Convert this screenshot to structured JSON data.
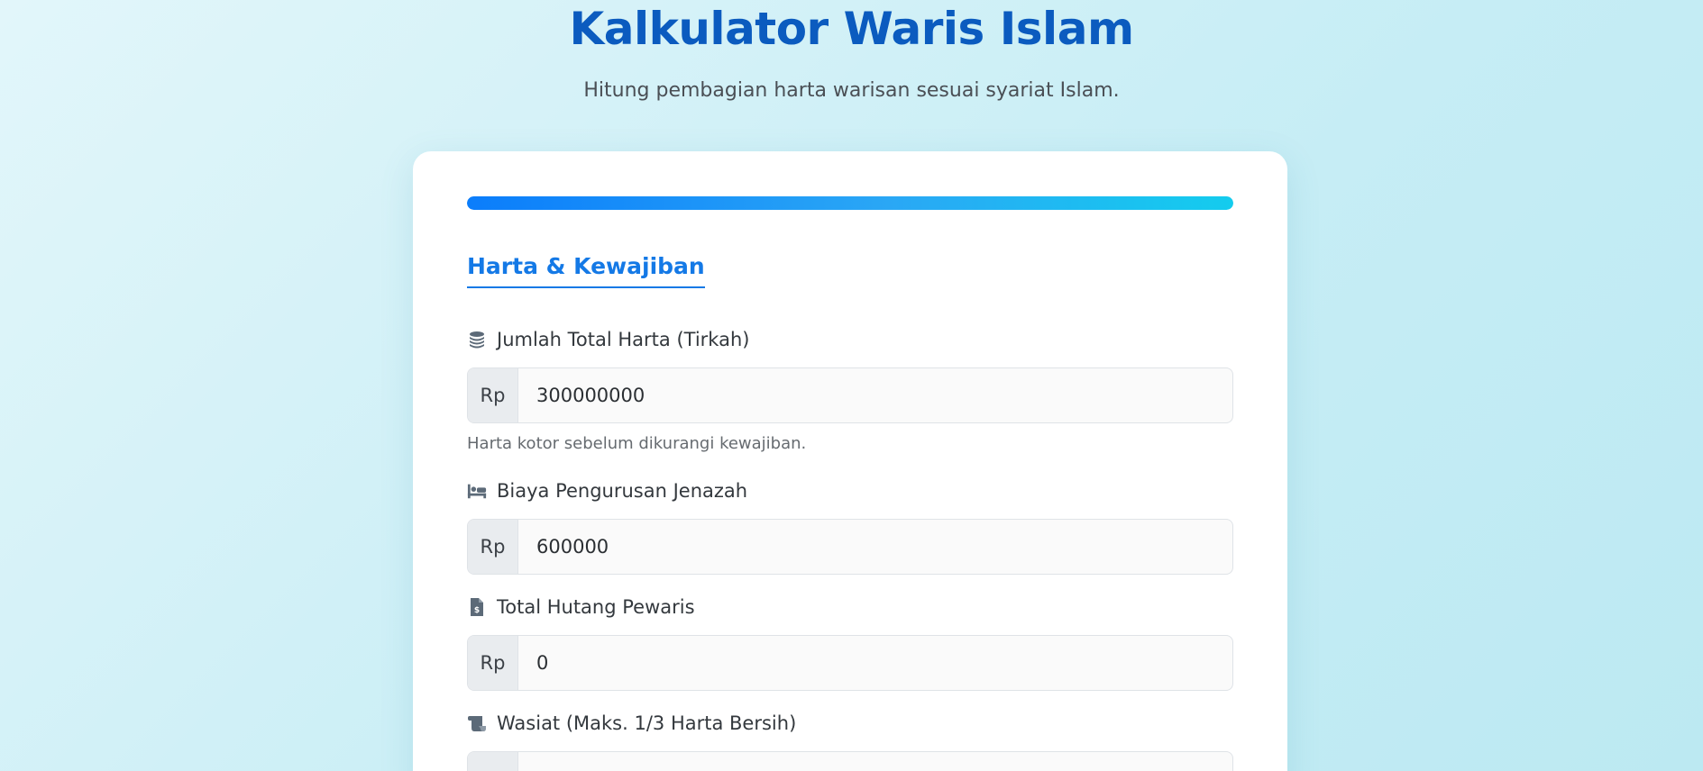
{
  "header": {
    "title": "Kalkulator Waris Islam",
    "subtitle": "Hitung pembagian harta warisan sesuai syariat Islam."
  },
  "progress": {
    "percent": 100
  },
  "section": {
    "title": "Harta & Kewajiban"
  },
  "fields": [
    {
      "icon": "coins-icon",
      "label": "Jumlah Total Harta (Tirkah)",
      "prefix": "Rp",
      "value": "300000000",
      "help": "Harta kotor sebelum dikurangi kewajiban."
    },
    {
      "icon": "bed-icon",
      "label": "Biaya Pengurusan Jenazah",
      "prefix": "Rp",
      "value": "600000"
    },
    {
      "icon": "file-invoice-dollar-icon",
      "label": "Total Hutang Pewaris",
      "prefix": "Rp",
      "value": "0"
    },
    {
      "icon": "scroll-icon",
      "label": "Wasiat (Maks. 1/3 Harta Bersih)",
      "prefix": "Rp",
      "value": ""
    }
  ],
  "colors": {
    "title": "#0b5bbf",
    "accent": "#1479e6"
  }
}
